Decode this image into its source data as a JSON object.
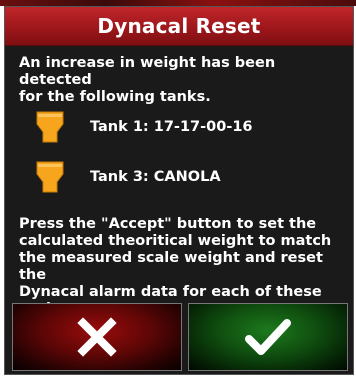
{
  "dialog": {
    "title": "Dynacal Reset",
    "intro": "An increase in weight has been detected\nfor the following tanks.",
    "tanks": [
      {
        "label": "Tank 1: 17-17-00-16",
        "icon": "tank-icon"
      },
      {
        "label": "Tank 3: CANOLA",
        "icon": "tank-icon"
      }
    ],
    "instructions": "Press the \"Accept\" button to set the\ncalculated theoritical weight to match\nthe measured scale weight and reset the\nDynacal alarm data for each of these\ntanks.",
    "buttons": {
      "cancel_icon": "x-icon",
      "accept_icon": "checkmark-icon"
    }
  },
  "colors": {
    "title_bar": "#9e171b",
    "tank_icon": "#f7a51c",
    "cancel_button": "#8b0a0a",
    "accept_button": "#146a14"
  }
}
